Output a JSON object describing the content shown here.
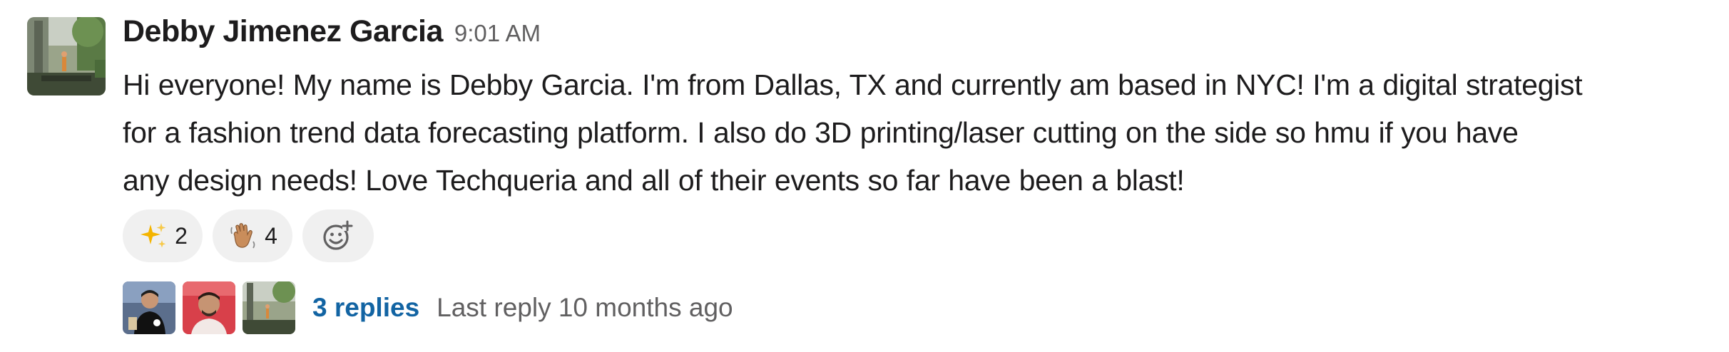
{
  "message": {
    "sender_name": "Debby Jimenez Garcia",
    "timestamp": "9:01 AM",
    "text_lines": [
      "Hi everyone! My name is Debby Garcia. I'm from Dallas, TX and currently am based in NYC! I'm a digital strategist",
      "for a fashion trend data forecasting platform. I also do 3D printing/laser cutting on the side so hmu if you have",
      "any design needs! Love Techqueria and all of their events so far have been a blast!"
    ]
  },
  "reactions": [
    {
      "icon": "sparkles-icon",
      "count": "2"
    },
    {
      "icon": "waving-hand-icon",
      "count": "4"
    }
  ],
  "add_reaction": {
    "icon": "add-reaction-icon"
  },
  "thread": {
    "replies_label": "3 replies",
    "last_reply_label": "Last reply 10 months ago"
  },
  "colors": {
    "link": "#1264a3",
    "reaction_bg": "#f0f0f0",
    "muted_text": "#616061"
  }
}
